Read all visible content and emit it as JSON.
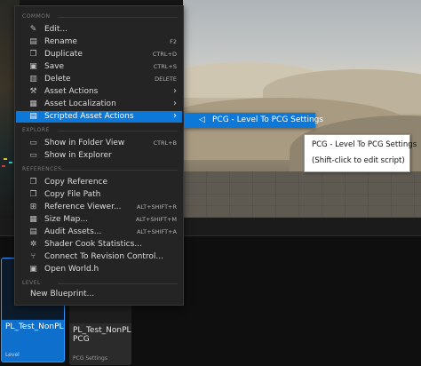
{
  "menu": {
    "sections": {
      "common": "COMMON",
      "explore": "EXPLORE",
      "references": "REFERENCES",
      "level": "LEVEL"
    },
    "common_items": [
      {
        "label": "Edit...",
        "shortcut": "",
        "icon": "pencil-icon"
      },
      {
        "label": "Rename",
        "shortcut": "F2",
        "icon": "rename-icon"
      },
      {
        "label": "Duplicate",
        "shortcut": "CTRL+D",
        "icon": "duplicate-icon"
      },
      {
        "label": "Save",
        "shortcut": "CTRL+S",
        "icon": "save-icon"
      },
      {
        "label": "Delete",
        "shortcut": "DELETE",
        "icon": "delete-icon"
      },
      {
        "label": "Asset Actions",
        "shortcut": "",
        "icon": "wrench-icon"
      },
      {
        "label": "Asset Localization",
        "shortcut": "",
        "icon": "localization-icon"
      },
      {
        "label": "Scripted Asset Actions",
        "shortcut": "",
        "icon": "script-icon"
      }
    ],
    "explore_items": [
      {
        "label": "Show in Folder View",
        "shortcut": "CTRL+B",
        "icon": "folder-icon"
      },
      {
        "label": "Show in Explorer",
        "shortcut": "",
        "icon": "folder-open-icon"
      }
    ],
    "reference_items": [
      {
        "label": "Copy Reference",
        "shortcut": "",
        "icon": "copy-icon"
      },
      {
        "label": "Copy File Path",
        "shortcut": "",
        "icon": "copy-icon"
      },
      {
        "label": "Reference Viewer...",
        "shortcut": "ALT+SHIFT+R",
        "icon": "reference-viewer-icon"
      },
      {
        "label": "Size Map...",
        "shortcut": "ALT+SHIFT+M",
        "icon": "size-map-icon"
      },
      {
        "label": "Audit Assets...",
        "shortcut": "ALT+SHIFT+A",
        "icon": "audit-icon"
      },
      {
        "label": "Shader Cook Statistics...",
        "shortcut": "",
        "icon": "shader-stats-icon"
      },
      {
        "label": "Connect To Revision Control...",
        "shortcut": "",
        "icon": "revision-control-icon"
      },
      {
        "label": "Open World.h",
        "shortcut": "",
        "icon": "code-file-icon"
      }
    ],
    "level_items": [
      {
        "label": "New Blueprint...",
        "shortcut": ""
      }
    ]
  },
  "submenu": {
    "label": "PCG - Level To PCG Settings",
    "icon": "back-arrow-icon"
  },
  "tooltip": {
    "title": "PCG - Level To PCG Settings",
    "hint": "(Shift-click to edit script)"
  },
  "assets": [
    {
      "name": "PL_Test_NonPLA",
      "type": "Level",
      "selected": true
    },
    {
      "name": "PL_Test_NonPLA_ PCG",
      "type": "PCG Settings",
      "selected": false
    }
  ],
  "colors": {
    "highlight": "#0d78d8",
    "menu_bg": "#242424",
    "pcg_accent": "#3ea787"
  }
}
